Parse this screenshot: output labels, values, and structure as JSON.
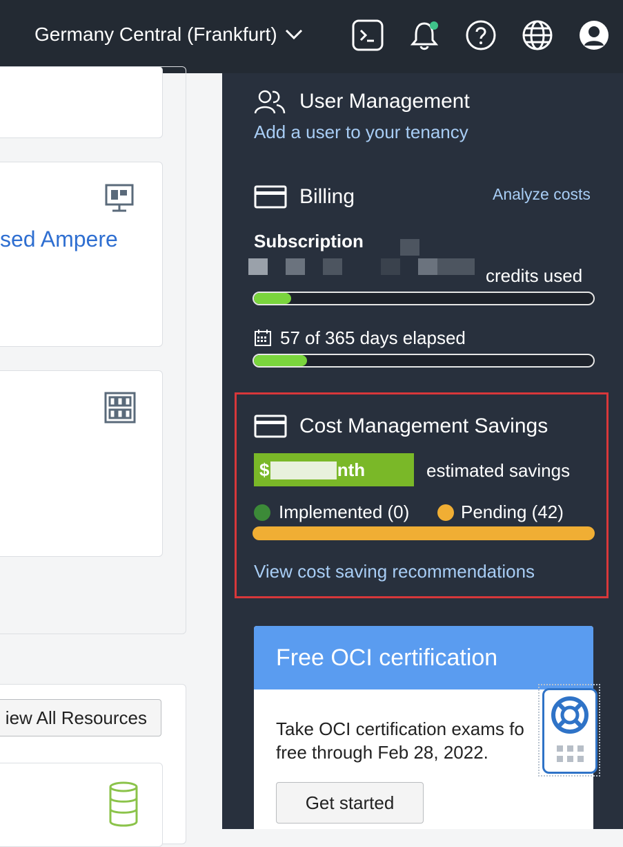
{
  "topbar": {
    "region": "Germany Central (Frankfurt)"
  },
  "left": {
    "ampere_text": "sed Ampere",
    "view_all": "iew All Resources"
  },
  "user_management": {
    "title": "User Management",
    "link": "Add a user to your tenancy"
  },
  "billing": {
    "title": "Billing",
    "analyze": "Analyze costs",
    "subscription": "Subscription",
    "credits_used": "credits used",
    "credits_used_fraction": 0.11,
    "days_elapsed": "57 of 365 days elapsed",
    "days_fraction": 0.156
  },
  "cost_savings": {
    "title": "Cost Management Savings",
    "amount": "$1    t/month",
    "estimated": "estimated savings",
    "implemented": "Implemented (0)",
    "pending": "Pending (42)",
    "link": "View cost saving recommendations"
  },
  "cert": {
    "title": "Free OCI certification",
    "line1": "Take OCI certification exams fo",
    "line2": "free through Feb 28, 2022.",
    "button": "Get started"
  },
  "colors": {
    "accent": "#2f6fd1",
    "progress": "#7ad53d",
    "pending": "#f0ae34",
    "implemented": "#3c8a38",
    "highlight": "#d8373a"
  },
  "icons": {
    "terminal": "terminal-icon",
    "bell": "bell-icon",
    "help": "help-icon",
    "globe": "globe-icon",
    "user": "user-avatar-icon"
  }
}
